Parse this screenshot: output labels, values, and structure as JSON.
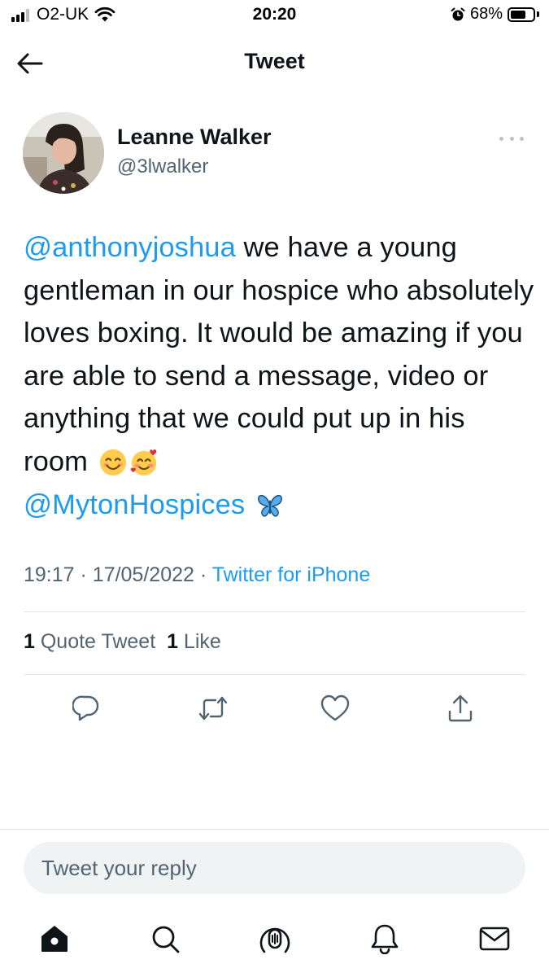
{
  "status_bar": {
    "carrier": "O2-UK",
    "time": "20:20",
    "battery_percent": "68%",
    "battery_level": 0.68,
    "signal_bars": 3,
    "icons": [
      "signal-icon",
      "wifi-icon",
      "alarm-icon",
      "battery-icon"
    ]
  },
  "header": {
    "title": "Tweet",
    "back_icon": "arrow-left-icon"
  },
  "tweet": {
    "author_name": "Leanne Walker",
    "author_handle": "@3lwalker",
    "mention_1": "@anthonyjoshua",
    "body": " we have a young gentleman in our hospice who absolutely loves boxing. It would be amazing if you are able to send a message, video or anything that we could put up in his room",
    "emojis": [
      "smiling-face-icon",
      "smiling-face-with-hearts-icon"
    ],
    "mention_2": "@MytonHospices",
    "trailing_emoji": "butterfly-icon",
    "time": "19:17",
    "separator": "·",
    "date": "17/05/2022",
    "source": "Twitter for iPhone",
    "quote_count": "1",
    "quote_label": "Quote Tweet",
    "like_count": "1",
    "like_label": "Like"
  },
  "actions": [
    "reply-icon",
    "retweet-icon",
    "like-icon",
    "share-icon"
  ],
  "reply": {
    "placeholder": "Tweet your reply"
  },
  "tabbar": [
    "home-icon",
    "search-icon",
    "spaces-icon",
    "notifications-icon",
    "messages-icon"
  ],
  "colors": {
    "accent": "#1d9bf0",
    "text": "#0f1419",
    "secondary": "#536471",
    "divider": "#e3e6e8",
    "reply_bg": "#eff3f4"
  }
}
